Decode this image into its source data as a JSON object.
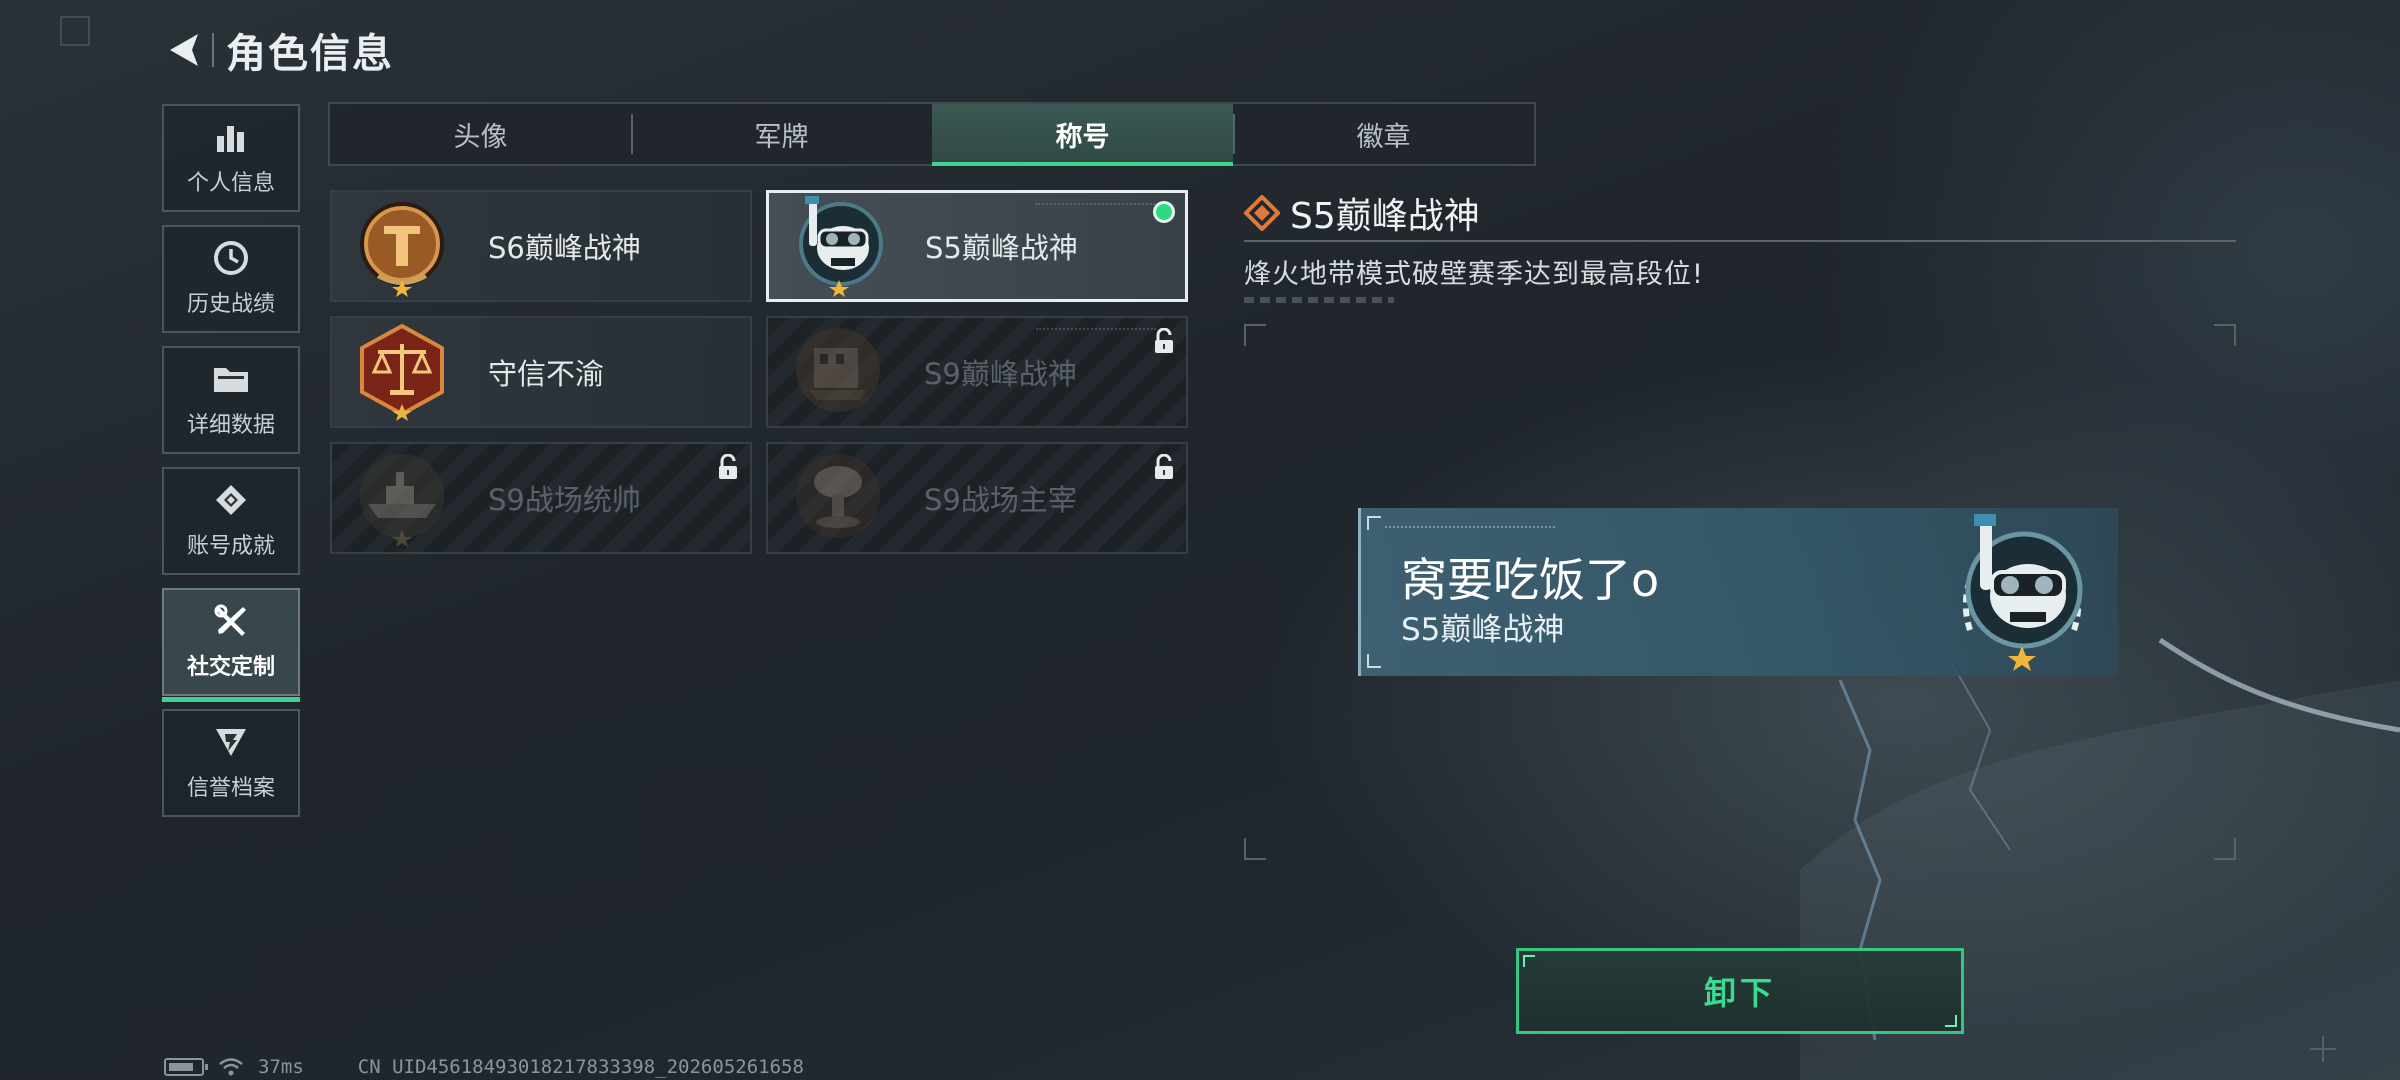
{
  "header": {
    "title": "角色信息"
  },
  "sidebar": {
    "items": [
      {
        "label": "个人信息",
        "icon": "bar-chart-icon"
      },
      {
        "label": "历史战绩",
        "icon": "clock-icon"
      },
      {
        "label": "详细数据",
        "icon": "folder-icon"
      },
      {
        "label": "账号成就",
        "icon": "achievement-icon"
      },
      {
        "label": "社交定制",
        "icon": "tools-icon",
        "active": true
      },
      {
        "label": "信誉档案",
        "icon": "credit-shield-icon"
      }
    ]
  },
  "tabs": [
    {
      "label": "头像"
    },
    {
      "label": "军牌"
    },
    {
      "label": "称号",
      "active": true
    },
    {
      "label": "徽章"
    }
  ],
  "titles": [
    {
      "name": "S6巅峰战神",
      "medal": "bronze-tower-medal-icon",
      "locked": false,
      "selected": false
    },
    {
      "name": "S5巅峰战神",
      "medal": "skull-diver-medal-icon",
      "locked": false,
      "selected": true,
      "equipped": true
    },
    {
      "name": "守信不渝",
      "medal": "scales-medal-icon",
      "locked": false,
      "selected": false
    },
    {
      "name": "S9巅峰战神",
      "medal": "ruins-medal-icon",
      "locked": true,
      "selected": false
    },
    {
      "name": "S9战场统帅",
      "medal": "warship-medal-icon",
      "locked": true,
      "selected": false
    },
    {
      "name": "S9战场主宰",
      "medal": "mushroom-cloud-medal-icon",
      "locked": true,
      "selected": false
    }
  ],
  "detail": {
    "title": "S5巅峰战神",
    "description": "烽火地带模式破壁赛季达到最高段位!"
  },
  "preview": {
    "player_name": "窝要吃饭了o",
    "title": "S5巅峰战神"
  },
  "actions": {
    "unequip_label": "卸下"
  },
  "status": {
    "ping": "37ms",
    "uid": "CN UID4561849301821783339​8_202605261658"
  },
  "colors": {
    "accent": "#3bd58f",
    "equipped": "#30d884",
    "diamond": "#e07a3a"
  }
}
